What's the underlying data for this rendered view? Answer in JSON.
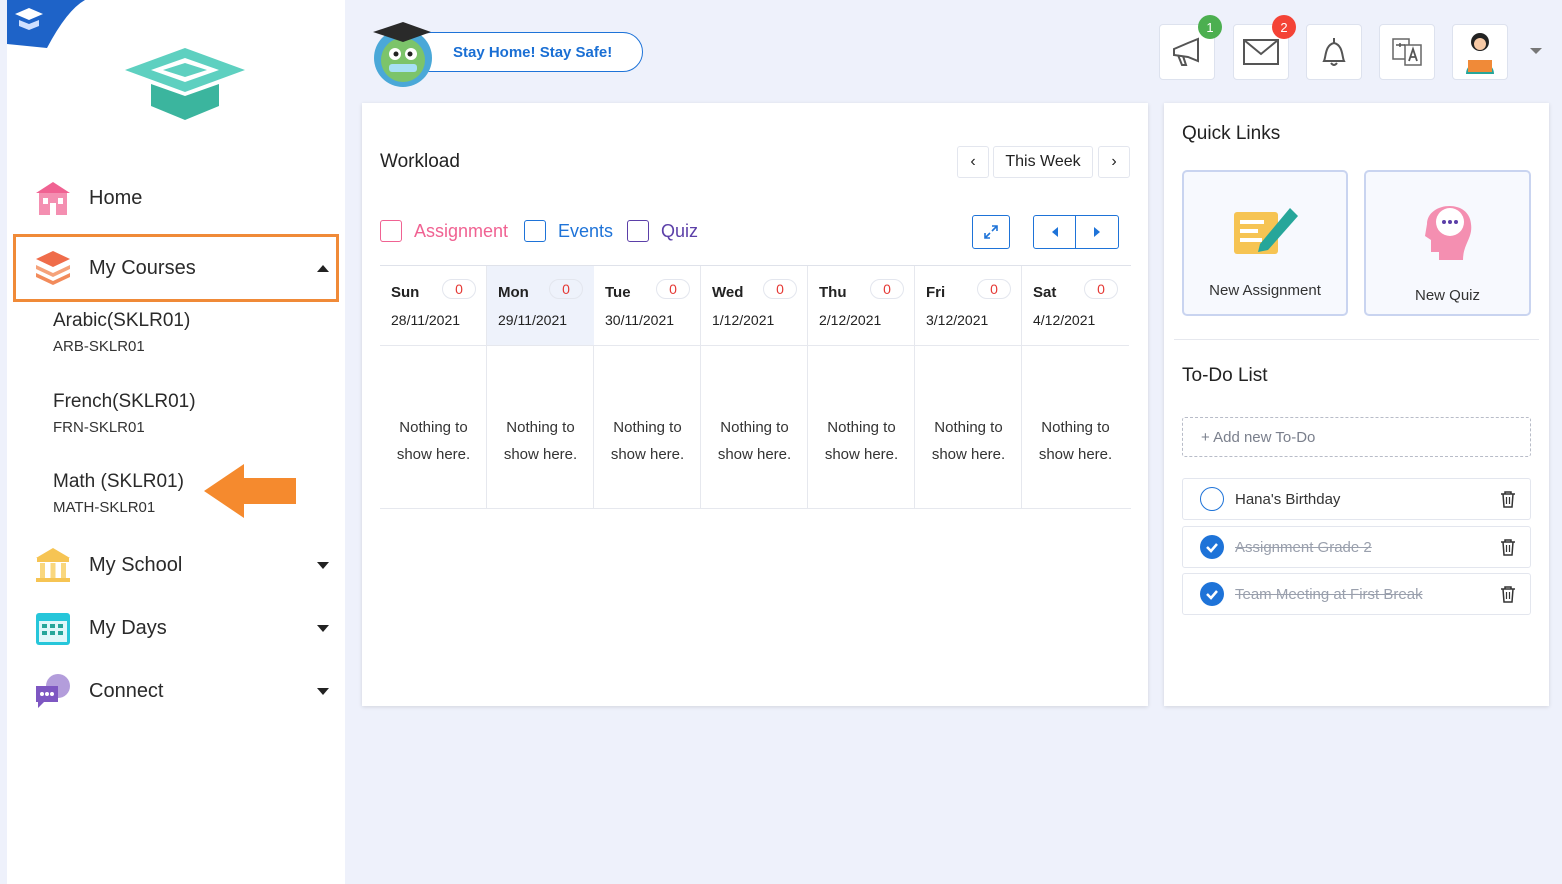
{
  "colors": {
    "accent": "#1e73d8",
    "active_border": "#f08a38",
    "badge_green": "#4caf50",
    "badge_red": "#f44336",
    "count_red": "#e53935",
    "assignment_pink": "#f06292",
    "events_blue": "#1e73d8",
    "quiz_purple": "#5b3fa8"
  },
  "sidebar": {
    "nav": [
      {
        "label": "Home",
        "icon": "school-building-icon"
      },
      {
        "label": "My Courses",
        "icon": "books-icon",
        "expanded": true
      },
      {
        "label": "My School",
        "icon": "columns-icon"
      },
      {
        "label": "My Days",
        "icon": "calendar-icon"
      },
      {
        "label": "Connect",
        "icon": "chat-bubbles-icon"
      }
    ],
    "courses": [
      {
        "name": "Arabic(SKLR01)",
        "code": "ARB-SKLR01"
      },
      {
        "name": "French(SKLR01)",
        "code": "FRN-SKLR01"
      },
      {
        "name": "Math (SKLR01)",
        "code": "MATH-SKLR01"
      }
    ]
  },
  "header": {
    "banner": "Stay Home! Stay Safe!",
    "announcements_badge": "1",
    "messages_badge": "2"
  },
  "workload": {
    "title": "Workload",
    "week_label": "This Week",
    "filters": {
      "assignment": "Assignment",
      "events": "Events",
      "quiz": "Quiz"
    },
    "days": [
      {
        "name": "Sun",
        "date": "28/11/2021",
        "count": "0",
        "empty1": "Nothing to",
        "empty2": "show here."
      },
      {
        "name": "Mon",
        "date": "29/11/2021",
        "count": "0",
        "empty1": "Nothing to",
        "empty2": "show here."
      },
      {
        "name": "Tue",
        "date": "30/11/2021",
        "count": "0",
        "empty1": "Nothing to",
        "empty2": "show here."
      },
      {
        "name": "Wed",
        "date": "1/12/2021",
        "count": "0",
        "empty1": "Nothing to",
        "empty2": "show here."
      },
      {
        "name": "Thu",
        "date": "2/12/2021",
        "count": "0",
        "empty1": "Nothing to",
        "empty2": "show here."
      },
      {
        "name": "Fri",
        "date": "3/12/2021",
        "count": "0",
        "empty1": "Nothing to",
        "empty2": "show here."
      },
      {
        "name": "Sat",
        "date": "4/12/2021",
        "count": "0",
        "empty1": "Nothing to",
        "empty2": "show here."
      }
    ]
  },
  "quick_links": {
    "title": "Quick Links",
    "new_assignment": "New Assignment",
    "new_quiz": "New Quiz"
  },
  "todo": {
    "title": "To-Do List",
    "add_placeholder": "+ Add new To-Do",
    "items": [
      {
        "text": "Hana's Birthday",
        "done": false
      },
      {
        "text": "Assignment Grade 2",
        "done": true
      },
      {
        "text": "Team Meeting at First Break",
        "done": true
      }
    ]
  }
}
